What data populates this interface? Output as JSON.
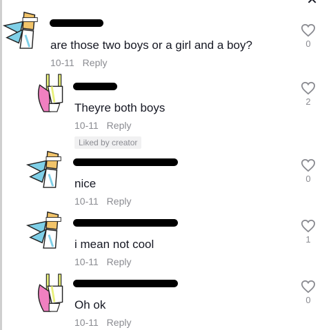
{
  "header": {
    "close_label": "✕"
  },
  "comments": [
    {
      "text": "are those two boys or a girl and a boy?",
      "date": "10-11",
      "reply_label": "Reply",
      "likes": "0",
      "liked_by_creator": ""
    },
    {
      "text": "Theyre both boys",
      "date": "10-11",
      "reply_label": "Reply",
      "likes": "2",
      "liked_by_creator": "Liked by creator"
    },
    {
      "text": "nice",
      "date": "10-11",
      "reply_label": "Reply",
      "likes": "0",
      "liked_by_creator": ""
    },
    {
      "text": "i mean not cool",
      "date": "10-11",
      "reply_label": "Reply",
      "likes": "1",
      "liked_by_creator": ""
    },
    {
      "text": "Oh ok",
      "date": "10-11",
      "reply_label": "Reply",
      "likes": "0",
      "liked_by_creator": ""
    }
  ]
}
